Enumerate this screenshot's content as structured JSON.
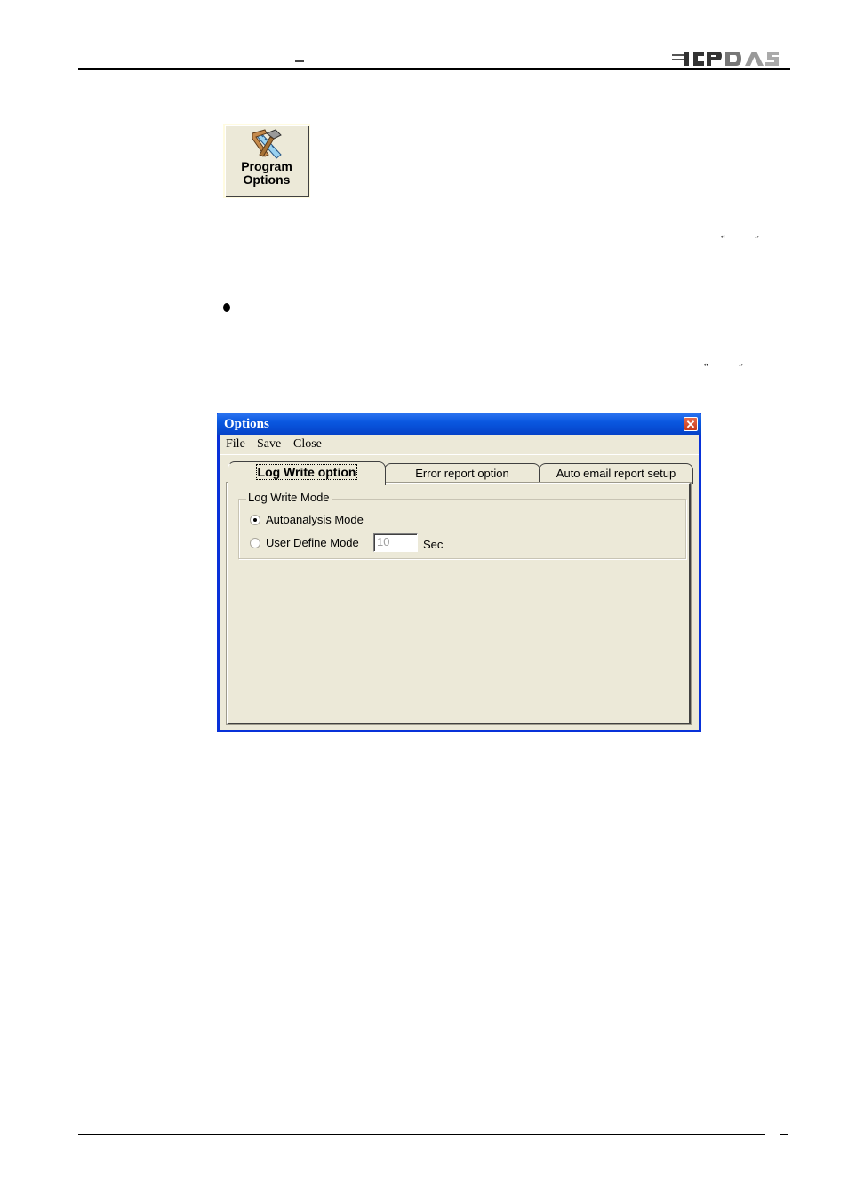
{
  "page": {
    "header_dash": "–",
    "logo_text": "ICPDAS",
    "footer_dash": "–"
  },
  "program_button": {
    "label_line1": "Program",
    "label_line2": "Options",
    "icon": "hammer-saw-icon"
  },
  "quotes": {
    "open": "“",
    "close": "”"
  },
  "dialog": {
    "title": "Options",
    "close_icon": "close-icon",
    "menu": [
      "File",
      "Save",
      "Close"
    ],
    "tabs": [
      {
        "label": "Log Write option",
        "active": true
      },
      {
        "label": "Error report option",
        "active": false
      },
      {
        "label": "Auto email report setup",
        "active": false
      }
    ],
    "group": {
      "legend": "Log Write Mode",
      "options": [
        {
          "label": "Autoanalysis Mode",
          "checked": true
        },
        {
          "label": "User Define Mode",
          "checked": false
        }
      ],
      "interval_value": "10",
      "interval_unit": "Sec"
    }
  },
  "colors": {
    "titlebar": "#0a58e0",
    "dialog_bg": "#ece9d8",
    "close_button": "#d5462a"
  }
}
